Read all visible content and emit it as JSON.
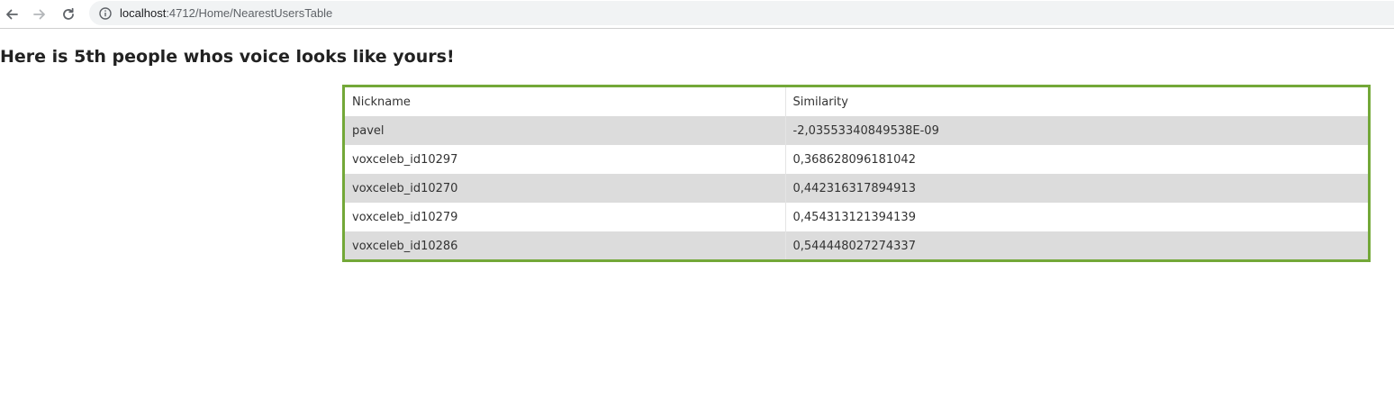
{
  "browser": {
    "url_host": "localhost",
    "url_rest": ":4712/Home/NearestUsersTable"
  },
  "page": {
    "title": "Here is 5th people whos voice looks like yours!"
  },
  "table": {
    "headers": [
      "Nickname",
      "Similarity"
    ],
    "rows": [
      {
        "nickname": "pavel",
        "similarity": "-2,03553340849538E-09"
      },
      {
        "nickname": "voxceleb_id10297",
        "similarity": "0,368628096181042"
      },
      {
        "nickname": "voxceleb_id10270",
        "similarity": "0,442316317894913"
      },
      {
        "nickname": "voxceleb_id10279",
        "similarity": "0,454313121394139"
      },
      {
        "nickname": "voxceleb_id10286",
        "similarity": "0,544448027274337"
      }
    ]
  },
  "colors": {
    "table_border": "#73a838",
    "row_stripe": "#dcdcdc"
  },
  "icons": [
    "back-arrow-icon",
    "forward-arrow-icon",
    "reload-icon",
    "info-icon"
  ]
}
